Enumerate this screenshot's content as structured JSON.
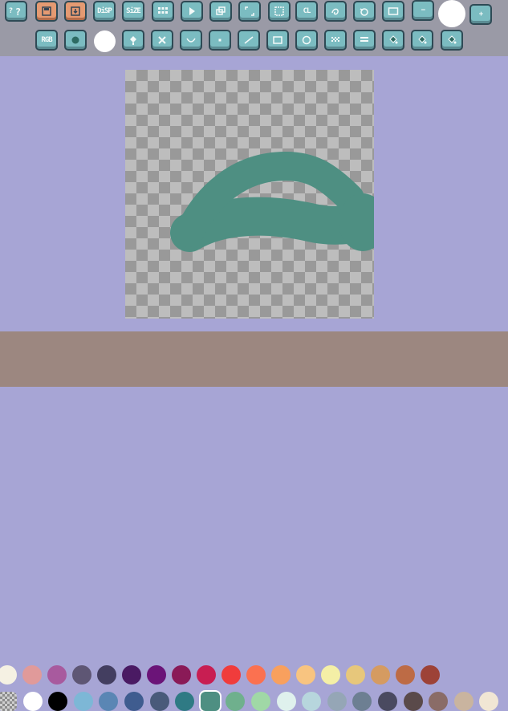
{
  "toolbar": {
    "row1": [
      {
        "name": "help-button",
        "label": "?",
        "icon": "question-icon",
        "style": "blue"
      },
      {
        "name": "save-button",
        "label": "",
        "icon": "save-icon",
        "style": "orange"
      },
      {
        "name": "load-button",
        "label": "",
        "icon": "download-icon",
        "style": "orange"
      },
      {
        "name": "disp-button",
        "label": "DiSP",
        "icon": "",
        "style": "blue"
      },
      {
        "name": "size-button",
        "label": "SiZE",
        "icon": "",
        "style": "blue"
      },
      {
        "name": "grid-button",
        "label": "",
        "icon": "grid-icon",
        "style": "blue"
      },
      {
        "name": "play-button",
        "label": "",
        "icon": "play-icon",
        "style": "blue"
      },
      {
        "name": "copy-layer-button",
        "label": "",
        "icon": "copy-icon",
        "style": "blue"
      },
      {
        "name": "fit-button",
        "label": "",
        "icon": "corners-icon",
        "style": "blue"
      },
      {
        "name": "select-button",
        "label": "",
        "icon": "selection-icon",
        "style": "blue"
      },
      {
        "name": "clear-button",
        "label": "CL",
        "icon": "",
        "style": "blue"
      },
      {
        "name": "undo-button",
        "label": "",
        "icon": "undo-icon",
        "style": "blue"
      },
      {
        "name": "rotate-button",
        "label": "",
        "icon": "rotate-icon",
        "style": "blue"
      },
      {
        "name": "frame-button",
        "label": "",
        "icon": "frame-icon",
        "style": "blue"
      }
    ],
    "size_minus": {
      "label": "−"
    },
    "size_plus": {
      "label": "+"
    },
    "row2": [
      {
        "name": "rgb-button",
        "label": "RGB",
        "icon": "",
        "style": "blue"
      },
      {
        "name": "color-button",
        "label": "",
        "icon": "circle-icon",
        "style": "blue"
      },
      {
        "name": "fill-button",
        "label": "",
        "icon": "fill-icon",
        "style": "blue"
      },
      {
        "name": "erase-button",
        "label": "",
        "icon": "x-icon",
        "style": "blue"
      },
      {
        "name": "curve-button",
        "label": "",
        "icon": "curve-icon",
        "style": "blue"
      },
      {
        "name": "dot-button",
        "label": "",
        "icon": "dot-icon",
        "style": "blue"
      },
      {
        "name": "line-button",
        "label": "",
        "icon": "line-icon",
        "style": "blue"
      },
      {
        "name": "rect-button",
        "label": "",
        "icon": "rect-icon",
        "style": "blue"
      },
      {
        "name": "ellipse-button",
        "label": "",
        "icon": "ellipse-icon",
        "style": "blue"
      },
      {
        "name": "tone1-button",
        "label": "",
        "icon": "checker-icon",
        "style": "blue"
      },
      {
        "name": "tone2-button",
        "label": "",
        "icon": "checker-dense-icon",
        "style": "blue"
      },
      {
        "name": "bucket-button",
        "label": "",
        "icon": "bucket-icon",
        "style": "blue"
      },
      {
        "name": "bucket2-button",
        "label": "",
        "icon": "bucket-icon",
        "style": "blue"
      },
      {
        "name": "bucket3-button",
        "label": "",
        "icon": "bucket-icon",
        "style": "blue"
      }
    ]
  },
  "palette": {
    "row1": [
      "#f5f1e3",
      "#e09a9a",
      "#a85a9e",
      "#5e5674",
      "#433e60",
      "#4a1a63",
      "#6b1478",
      "#8a1a57",
      "#c81e52",
      "#f03c3c",
      "#fb7150",
      "#f8a05e",
      "#f8c480",
      "#f4efa6",
      "#e7c77b",
      "#d59b61",
      "#bd6b45",
      "#9d4237"
    ],
    "row2": [
      "#bfbfbf",
      "#ffffff",
      "#000000",
      "#7db7d6",
      "#5a86b4",
      "#3f5c8f",
      "#495a7a",
      "#2f7a84",
      "#4e8f82",
      "#6fb08d",
      "#a0d8a6",
      "#dff1ed",
      "#b7d6dd",
      "#95a6b6",
      "#6d7f92",
      "#4a4a60",
      "#5a4a4a",
      "#8a6c67",
      "#c9b49f",
      "#f1e6d4"
    ],
    "selected": "#4e8f82"
  },
  "stroke_color": "#4e8f82"
}
